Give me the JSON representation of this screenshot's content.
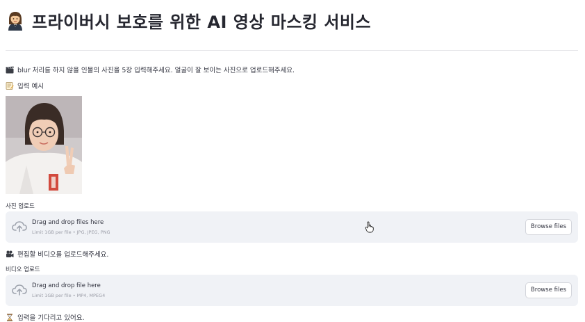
{
  "title": {
    "text": "프라이버시 보호를 위한 AI 영상 마스킹 서비스",
    "icon": "person-in-tuxedo-emoji"
  },
  "instruction": {
    "text": "blur 처리를 하지 않을 인물의 사진을 5장 입력해주세요. 얼굴이 잘 보이는 사진으로 업로드해주세요.",
    "icon": "clapperboard-emoji"
  },
  "example": {
    "text": "입력 예시",
    "icon": "memo-emoji"
  },
  "photo_upload": {
    "label": "사진 업로드",
    "main_text": "Drag and drop files here",
    "limit_text": "Limit 1GB per file • JPG, JPEG, PNG",
    "button_label": "Browse files",
    "icon": "cloud-upload-icon"
  },
  "video_prompt": {
    "text": "편집할 비디오를 업로드해주세요.",
    "icon": "video-camera-emoji"
  },
  "video_upload": {
    "label": "비디오 업로드",
    "main_text": "Drag and drop file here",
    "limit_text": "Limit 1GB per file • MP4, MPEG4",
    "button_label": "Browse files",
    "icon": "cloud-upload-icon"
  },
  "status": {
    "text": "입력을 기다리고 있어요.",
    "icon": "hourglass-emoji"
  },
  "colors": {
    "background": "#ffffff",
    "dropzone": "#f0f2f6",
    "text": "#31333f",
    "muted": "#9a9ca6"
  }
}
